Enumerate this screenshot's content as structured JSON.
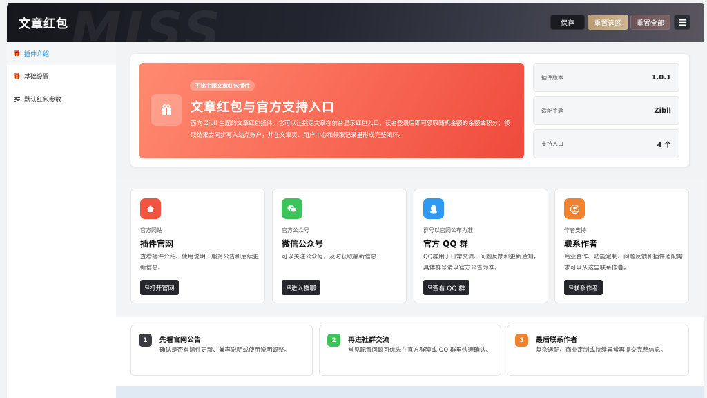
{
  "header": {
    "title": "文章红包",
    "watermark": "MISS",
    "buttons": {
      "save": "保存",
      "reset_selection": "重置选区",
      "reset_all": "重置全部",
      "menu_icon": "menu-icon"
    }
  },
  "sidebar": {
    "items": [
      {
        "label": "插件介绍",
        "icon": "gift-icon",
        "active": true
      },
      {
        "label": "基础设置",
        "icon": "gift-icon",
        "active": false
      },
      {
        "label": "默认红包参数",
        "icon": "sliders-icon",
        "active": false
      }
    ]
  },
  "hero": {
    "tag": "子比主题文章红包插件",
    "title": "文章红包与官方支持入口",
    "description": "面向 Zibll 主题的文章红包插件。它可以让指定文章在前台显示红包入口，读者登录后即可领取随机金额的余额或积分；领取结果会同步写入站点账户，并在文章页、用户中心和领取记录里形成完整闭环。",
    "info": [
      {
        "label": "插件版本",
        "value": "1.0.1"
      },
      {
        "label": "适配主题",
        "value": "Zibll"
      },
      {
        "label": "支持入口",
        "value": "4 个"
      }
    ]
  },
  "cards": [
    {
      "icon": "home-icon",
      "color": "#f2553f",
      "sub": "官方网站",
      "title": "插件官网",
      "desc": "查看插件介绍、使用说明、服务公告和后续更新信息。",
      "button": "打开官网"
    },
    {
      "icon": "wechat-icon",
      "color": "#3cc45a",
      "sub": "官方公众号",
      "title": "微信公众号",
      "desc": "可以关注公众号，及时获取最新信息",
      "button": "进入群聊"
    },
    {
      "icon": "qq-icon",
      "color": "#2f9af0",
      "sub": "群号以官网公布为准",
      "title": "官方 QQ 群",
      "desc": "QQ群用于日常交流、问题反馈和更新通知，具体群号请以官方公告为准。",
      "button": "查看 QQ 群"
    },
    {
      "icon": "user-icon",
      "color": "#f0822f",
      "sub": "作者支持",
      "title": "联系作者",
      "desc": "商业合作、功能定制、问题反馈和插件适配需求可以从这里联系作者。",
      "button": "联系作者"
    }
  ],
  "steps": [
    {
      "num": "1",
      "color": "#3a3c42",
      "title": "先看官网公告",
      "desc": "确认是否有插件更新、兼容说明或使用说明调整。"
    },
    {
      "num": "2",
      "color": "#3cc45a",
      "title": "再进社群交流",
      "desc": "常见配置问题可优先在官方群聊或 QQ 群里快速确认。"
    },
    {
      "num": "3",
      "color": "#f0822f",
      "title": "最后联系作者",
      "desc": "复杂适配、商业定制或持续异常再提交完整信息。"
    }
  ]
}
